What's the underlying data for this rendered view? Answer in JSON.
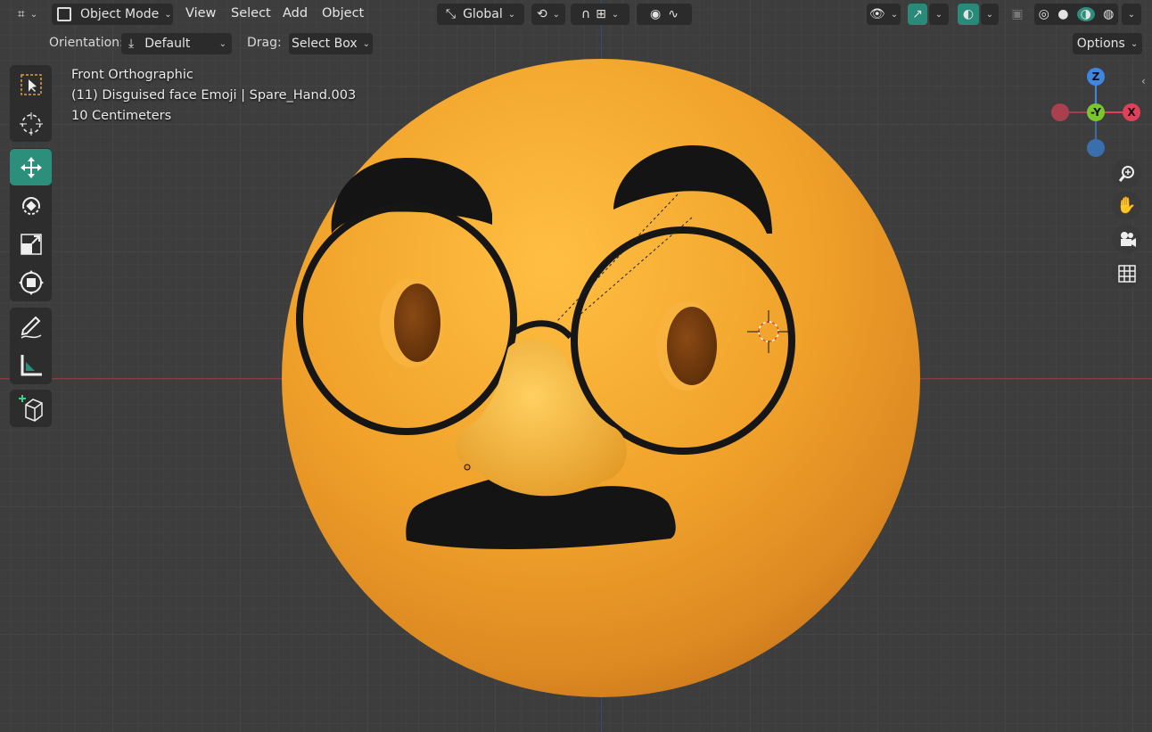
{
  "header": {
    "editor_type_icon": "editor-type-icon",
    "mode": "Object Mode",
    "menus": [
      "View",
      "Select",
      "Add",
      "Object"
    ],
    "transform_orientation": "Global",
    "snap_icons": [
      "pivot-icon",
      "snap-magnet-icon",
      "snap-increment-icon",
      "proportional-edit-icon",
      "falloff-icon"
    ],
    "right_icons": [
      "visibility-icon",
      "gizmo-icon",
      "overlay-icon",
      "xray-icon",
      "wireframe-shading-icon",
      "solid-shading-icon",
      "material-shading-icon",
      "rendered-shading-icon"
    ]
  },
  "toolsettings": {
    "orientation_label": "Orientation:",
    "orientation_value": "Default",
    "drag_label": "Drag:",
    "drag_value": "Select Box",
    "options_label": "Options"
  },
  "viewport": {
    "view_name": "Front Orthographic",
    "object_info": "(11) Disguised face Emoji | Spare_Hand.003",
    "scale_info": "10 Centimeters"
  },
  "toolbar": [
    "select-box-tool",
    "cursor-tool",
    "move-tool",
    "rotate-tool",
    "scale-tool",
    "transform-tool",
    "annotate-tool",
    "measure-tool",
    "add-cube-tool"
  ],
  "gizmo": {
    "z": "Z",
    "y": "-Y",
    "x": "X"
  },
  "colors": {
    "accent": "#2b8f7b",
    "x_axis": "#e0405a",
    "y_axis": "#7ac62e",
    "z_axis": "#3f86e0",
    "emoji": "#f2a42a"
  }
}
